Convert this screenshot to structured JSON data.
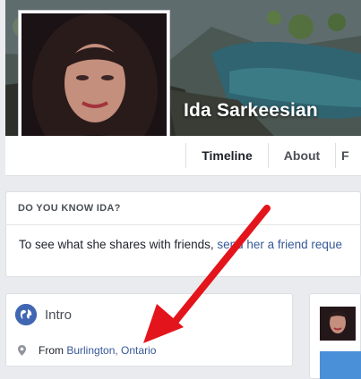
{
  "profile": {
    "name": "Ida Sarkeesian"
  },
  "tabs": [
    {
      "label": "Timeline",
      "active": true
    },
    {
      "label": "About",
      "active": false
    },
    {
      "label": "F",
      "active": false
    }
  ],
  "know_card": {
    "heading": "DO YOU KNOW IDA?",
    "text_prefix": "To see what she shares with friends, ",
    "link_text": "send her a friend reque"
  },
  "intro": {
    "title": "Intro",
    "from_prefix": "From ",
    "location": "Burlington, Ontario"
  },
  "icons": {
    "globe": "globe-icon",
    "pin": "location-pin-icon"
  },
  "colors": {
    "link": "#365899",
    "annotation_arrow": "#e3141b",
    "globe": "#4267b2"
  }
}
